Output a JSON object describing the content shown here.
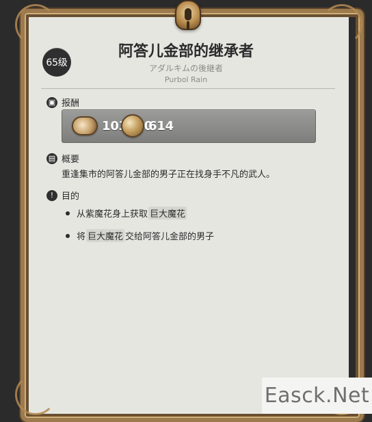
{
  "quest": {
    "level_badge": "65级",
    "title": "阿答儿金部的继承者",
    "subtitle_jp": "アダルキムの後継者",
    "subtitle_en": "Purbol Rain"
  },
  "sections": {
    "rewards_label": "报酬",
    "summary_label": "概要",
    "objectives_label": "目的"
  },
  "rewards": {
    "exp_value": "103950",
    "gil_value": "614"
  },
  "summary": {
    "text": "重逢集市的阿答儿金部的男子正在找身手不凡的武人。"
  },
  "objectives": [
    {
      "parts": [
        {
          "text": "从紫魔花身上获取",
          "highlight": false
        },
        {
          "text": "巨大魔花",
          "highlight": true
        }
      ]
    },
    {
      "parts": [
        {
          "text": "将",
          "highlight": false
        },
        {
          "text": "巨大魔花",
          "highlight": true
        },
        {
          "text": "交给阿答儿金部的男子",
          "highlight": false
        }
      ]
    }
  ],
  "icons": {
    "rewards": "box-icon",
    "summary": "book-icon",
    "objectives": "exclamation-icon"
  },
  "watermark": {
    "text": "Easck.Net"
  }
}
